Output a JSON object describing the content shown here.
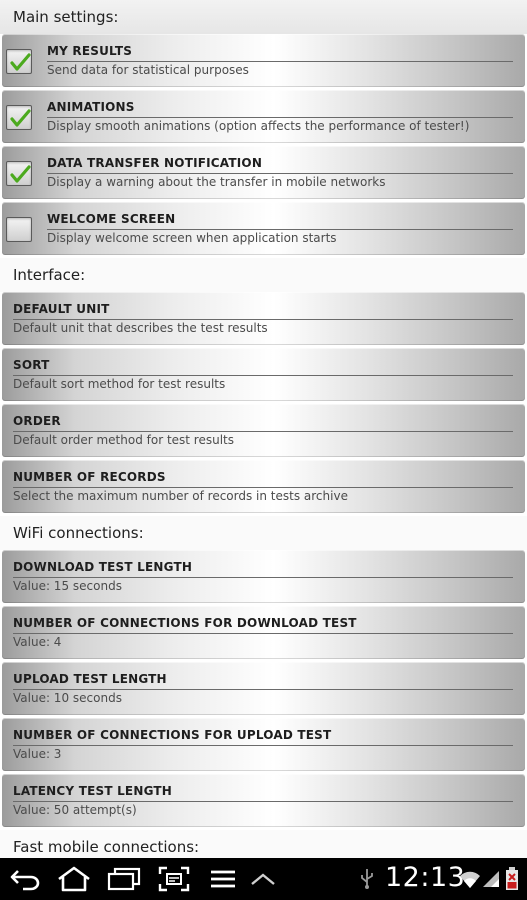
{
  "sections": {
    "main": {
      "title": "Main settings:"
    },
    "interface": {
      "title": "Interface:"
    },
    "wifi": {
      "title": "WiFi connections:"
    },
    "fast_mobile": {
      "title": "Fast mobile connections:"
    }
  },
  "main_items": [
    {
      "title": "MY RESULTS",
      "summary": "Send data for statistical purposes",
      "checked": true
    },
    {
      "title": "ANIMATIONS",
      "summary": "Display smooth animations (option affects the performance of tester!)",
      "checked": true
    },
    {
      "title": "DATA TRANSFER NOTIFICATION",
      "summary": "Display a warning about the transfer in mobile networks",
      "checked": true
    },
    {
      "title": "WELCOME SCREEN",
      "summary": "Display welcome screen when application starts",
      "checked": false
    }
  ],
  "interface_items": [
    {
      "title": "DEFAULT UNIT",
      "summary": "Default unit that describes the test results"
    },
    {
      "title": "SORT",
      "summary": "Default sort method for test results"
    },
    {
      "title": "ORDER",
      "summary": "Default order method for test results"
    },
    {
      "title": "NUMBER OF RECORDS",
      "summary": "Select the maximum number of records in tests archive"
    }
  ],
  "wifi_items": [
    {
      "title": "DOWNLOAD TEST LENGTH",
      "summary": "Value: 15 seconds"
    },
    {
      "title": "NUMBER OF CONNECTIONS FOR DOWNLOAD TEST",
      "summary": "Value: 4"
    },
    {
      "title": "UPLOAD TEST LENGTH",
      "summary": "Value: 10 seconds"
    },
    {
      "title": "NUMBER OF CONNECTIONS FOR UPLOAD TEST",
      "summary": "Value: 3"
    },
    {
      "title": "LATENCY TEST LENGTH",
      "summary": "Value: 50 attempt(s)"
    }
  ],
  "status_bar": {
    "time": "12:13",
    "icons": [
      "usb-icon",
      "wifi-icon",
      "signal-icon",
      "battery-icon"
    ]
  },
  "nav_icons": [
    "back-icon",
    "home-icon",
    "recent-apps-icon",
    "screenshot-icon",
    "menu-icon",
    "chevron-up-icon"
  ],
  "colors": {
    "check": "#4caa1e",
    "navbar": "#000000",
    "battery_alert": "#c81e1e"
  }
}
